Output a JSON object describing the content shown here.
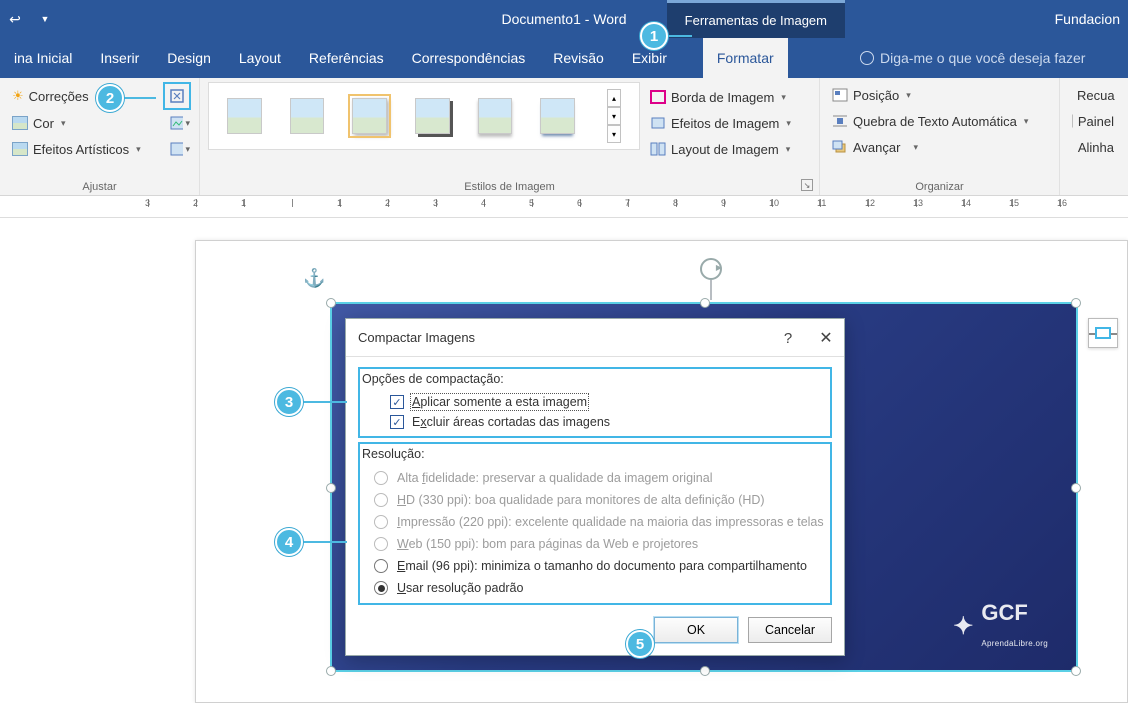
{
  "titlebar": {
    "doc_title": "Documento1 - Word",
    "contextual_tab": "Ferramentas de Imagem",
    "right_text": "Fundacion"
  },
  "tabs": {
    "home": "ina Inicial",
    "insert": "Inserir",
    "design": "Design",
    "layout": "Layout",
    "references": "Referências",
    "mailings": "Correspondências",
    "review": "Revisão",
    "view": "Exibir",
    "format": "Formatar",
    "tellme": "Diga-me o que você deseja fazer"
  },
  "ribbon": {
    "adjust": {
      "corrections": "Correções",
      "color": "Cor",
      "artistic": "Efeitos Artísticos",
      "label": "Ajustar"
    },
    "styles_label": "Estilos de Imagem",
    "border": "Borda de Imagem",
    "effects": "Efeitos de Imagem",
    "layout_img": "Layout de Imagem",
    "position": "Posição",
    "wrap": "Quebra de Texto Automática",
    "forward": "Avançar",
    "arrange_label": "Organizar",
    "recuar": "Recua",
    "painel": "Painel",
    "alinhar": "Alinha"
  },
  "ruler": {
    "marks": [
      "3",
      "2",
      "1",
      "",
      "1",
      "2",
      "3",
      "4",
      "5",
      "6",
      "7",
      "8",
      "9",
      "10",
      "11",
      "12",
      "13",
      "14",
      "15",
      "16"
    ]
  },
  "image_logo": {
    "text": "GCF",
    "sub": "AprendaLibre.org"
  },
  "dialog": {
    "title": "Compactar Imagens",
    "section_compress": "Opções de compactação:",
    "chk_apply": "Aplicar somente a esta imagem",
    "chk_exclude": "Excluir áreas cortadas das imagens",
    "section_res": "Resolução:",
    "r_fidelity": "Alta fidelidade: preservar a qualidade da imagem original",
    "r_hd": "HD (330 ppi): boa qualidade para monitores de alta definição (HD)",
    "r_print": "Impressão (220 ppi): excelente qualidade na maioria das impressoras e telas",
    "r_web": "Web (150 ppi): bom para páginas da Web e projetores",
    "r_email": "Email (96 ppi): minimiza o tamanho do documento para compartilhamento",
    "r_default": "Usar resolução padrão",
    "ok": "OK",
    "cancel": "Cancelar"
  },
  "callouts": {
    "c1": "1",
    "c2": "2",
    "c3": "3",
    "c4": "4",
    "c5": "5"
  }
}
